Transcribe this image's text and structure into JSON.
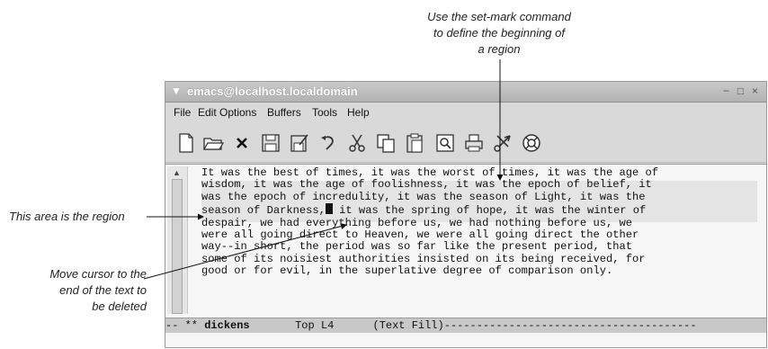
{
  "callouts": {
    "set_mark": [
      "Use the set-mark command",
      "to define the beginning of",
      "a region"
    ],
    "region": "This area is the region",
    "cursor": [
      "Move cursor to the",
      "end of the text to",
      "be deleted"
    ]
  },
  "window": {
    "title": "emacs@localhost.localdomain",
    "controls": {
      "minimize": "−",
      "maximize": "□",
      "close": "×"
    }
  },
  "menubar": [
    "File",
    "Edit",
    "Options",
    "Buffers",
    "Tools",
    "Help"
  ],
  "toolbar": [
    "new-file-icon",
    "open-folder-icon",
    "close-x-icon",
    "save-icon",
    "save-as-icon",
    "undo-icon",
    "cut-icon",
    "copy-icon",
    "paste-icon",
    "search-icon",
    "print-icon",
    "customize-icon",
    "help-icon"
  ],
  "buffer": {
    "lines": [
      "It was the best of times, it was the worst of times, it was the age of",
      "wisdom, it was the age of foolishness, it was the epoch of belief, it",
      "was the epoch of incredulity, it was the season of Light, it was the",
      "season of Darkness,",
      " it was the spring of hope, it was the winter of",
      "despair, we had everything before us, we had nothing before us, we",
      "were all going direct to Heaven, we were all going direct the other",
      "way--in short, the period was so far like the present period, that",
      "some of its noisiest authorities insisted on its being received, for",
      "good or for evil, in the superlative degree of comparison only."
    ]
  },
  "modeline": {
    "prefix": "-- ** ",
    "buffer_name": "dickens",
    "position": "Top L4",
    "mode": "(Text Fill)",
    "fill": "---------------------------------------"
  }
}
